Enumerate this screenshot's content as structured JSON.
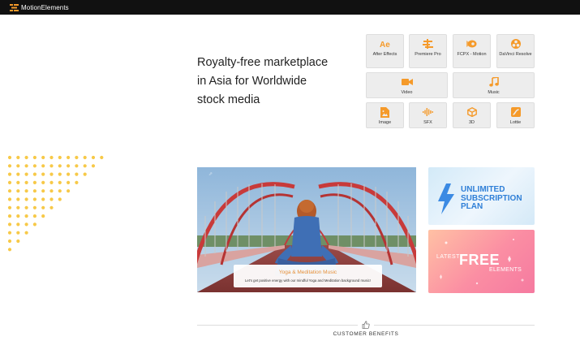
{
  "brand": {
    "name": "MotionElements",
    "logo_icon": "motionelements-logo-icon"
  },
  "hero_text": {
    "line1": "Royalty-free marketplace",
    "line2": "in Asia for Worldwide",
    "line3": "stock media"
  },
  "categories": [
    {
      "label": "After Effects",
      "icon": "after-effects-icon"
    },
    {
      "label": "Premiere Pro",
      "icon": "premiere-pro-icon"
    },
    {
      "label": "FCPX - Motion",
      "icon": "fcpx-motion-icon"
    },
    {
      "label": "DaVinci Resolve",
      "icon": "davinci-resolve-icon"
    },
    {
      "label": "Video",
      "icon": "video-camera-icon"
    },
    {
      "label": "Music",
      "icon": "music-note-icon"
    },
    {
      "label": "Image",
      "icon": "image-file-icon"
    },
    {
      "label": "SFX",
      "icon": "sound-wave-icon"
    },
    {
      "label": "3D",
      "icon": "cube-3d-icon"
    },
    {
      "label": "Lottie",
      "icon": "lottie-icon"
    }
  ],
  "feature": {
    "title": "Yoga & Meditation Music",
    "subtitle": "Let's get positive energy with our mindful Yoga and Meditation background music!"
  },
  "promos": {
    "unlimited": {
      "line1": "UNLIMITED",
      "line2": "SUBSCRIPTION",
      "line3": "PLAN"
    },
    "free": {
      "pre": "LATEST",
      "big": "FREE",
      "post": "ELEMENTS"
    }
  },
  "benefits": {
    "title": "CUSTOMER BENEFITS",
    "icon": "thumbs-up-icon"
  },
  "colors": {
    "accent_orange": "#f59a2a",
    "dots_yellow": "#f7c948",
    "promo_blue": "#2f7fd7",
    "promo_pink": "#f57aa0"
  }
}
